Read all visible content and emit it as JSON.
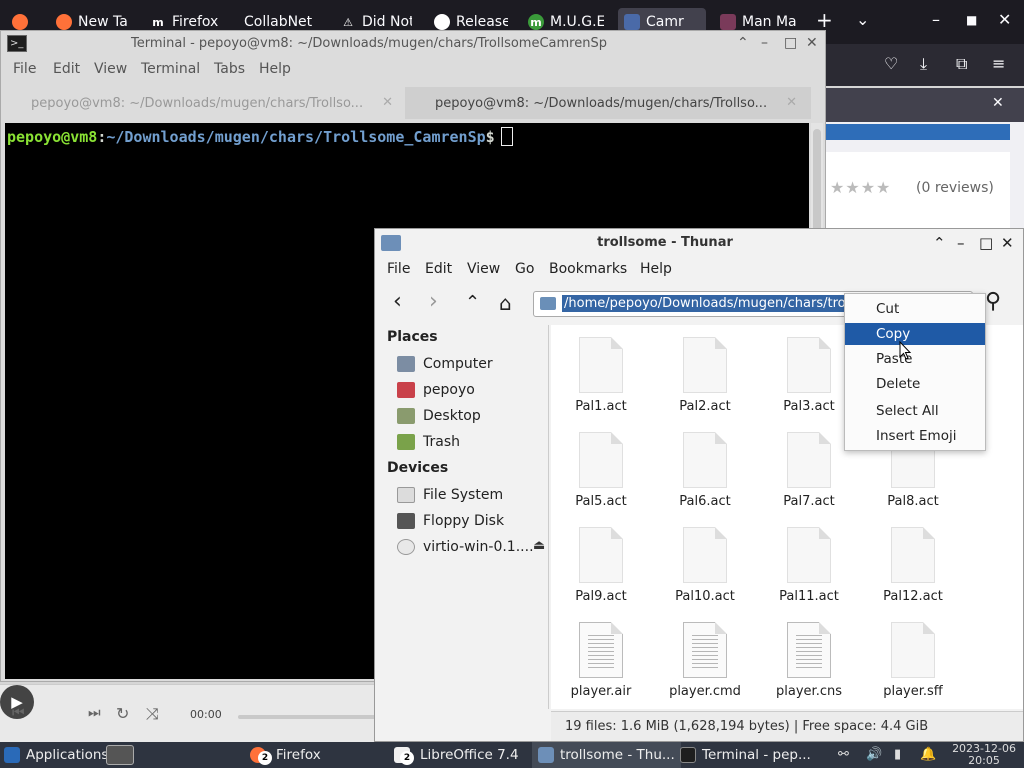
{
  "firefox": {
    "tabs": [
      {
        "label": "New Tab",
        "fav": "firefox-icon",
        "color": "#ff7139"
      },
      {
        "label": "Firefox |",
        "fav": "m-logo-icon",
        "color": "#ffffff"
      },
      {
        "label": "CollabNet",
        "fav": "",
        "color": ""
      },
      {
        "label": "Did Not",
        "fav": "warning-icon",
        "color": "#ffffff"
      },
      {
        "label": "Release",
        "fav": "github-icon",
        "color": "#ffffff"
      },
      {
        "label": "M.U.G.E",
        "fav": "mugen-icon",
        "color": "#3a9a3a"
      },
      {
        "label": "Camr",
        "fav": "character-icon",
        "color": "#4a6aa8"
      },
      {
        "label": "Man Ma",
        "fav": "character-icon",
        "color": "#7a3a5a"
      }
    ],
    "reviews": "(0 reviews)",
    "stars": "★★★★"
  },
  "terminal": {
    "title": "Terminal - pepoyo@vm8: ~/Downloads/mugen/chars/TrollsomeCamrenSp",
    "menu": [
      "File",
      "Edit",
      "View",
      "Terminal",
      "Tabs",
      "Help"
    ],
    "tabs": [
      {
        "label": "pepoyo@vm8: ~/Downloads/mugen/chars/Trollso..."
      },
      {
        "label": "pepoyo@vm8: ~/Downloads/mugen/chars/Trollso..."
      }
    ],
    "prompt_user": "pepoyo@vm8",
    "prompt_colon": ":",
    "prompt_path": "~/Downloads/mugen/chars/Trollsome_CamrenSp",
    "prompt_symbol": "$"
  },
  "media": {
    "time": "00:00"
  },
  "thunar": {
    "title": "trollsome - Thunar",
    "menu": [
      "File",
      "Edit",
      "View",
      "Go",
      "Bookmarks",
      "Help"
    ],
    "path": "/home/pepoyo/Downloads/mugen/chars/trol",
    "sidebar": {
      "places_heading": "Places",
      "places": [
        "Computer",
        "pepoyo",
        "Desktop",
        "Trash"
      ],
      "devices_heading": "Devices",
      "devices": [
        "File System",
        "Floppy Disk",
        "virtio-win-0.1...."
      ]
    },
    "files": [
      {
        "name": "Pal1.act",
        "kind": "blank"
      },
      {
        "name": "Pal2.act",
        "kind": "blank"
      },
      {
        "name": "Pal3.act",
        "kind": "blank"
      },
      {
        "name": "",
        "kind": "hidden"
      },
      {
        "name": "Pal5.act",
        "kind": "blank"
      },
      {
        "name": "Pal6.act",
        "kind": "blank"
      },
      {
        "name": "Pal7.act",
        "kind": "blank"
      },
      {
        "name": "Pal8.act",
        "kind": "blank"
      },
      {
        "name": "Pal9.act",
        "kind": "blank"
      },
      {
        "name": "Pal10.act",
        "kind": "blank"
      },
      {
        "name": "Pal11.act",
        "kind": "blank"
      },
      {
        "name": "Pal12.act",
        "kind": "blank"
      },
      {
        "name": "player.air",
        "kind": "text"
      },
      {
        "name": "player.cmd",
        "kind": "text"
      },
      {
        "name": "player.cns",
        "kind": "text"
      },
      {
        "name": "player.sff",
        "kind": "blank"
      }
    ],
    "status": "19 files: 1.6 MiB (1,628,194 bytes)  |  Free space: 4.4 GiB"
  },
  "context_menu": {
    "items": [
      "Cut",
      "Copy",
      "Paste",
      "Delete",
      "Select All",
      "Insert Emoji"
    ],
    "highlighted": "Copy"
  },
  "taskbar": {
    "applications": "Applications",
    "items": [
      {
        "label": "Firefox",
        "count": "2"
      },
      {
        "label": "LibreOffice 7.4",
        "count": "2"
      },
      {
        "label": "trollsome - Thu...",
        "count": ""
      },
      {
        "label": "Terminal - pep...",
        "count": ""
      }
    ],
    "date": "2023-12-06",
    "time": "20:05"
  }
}
